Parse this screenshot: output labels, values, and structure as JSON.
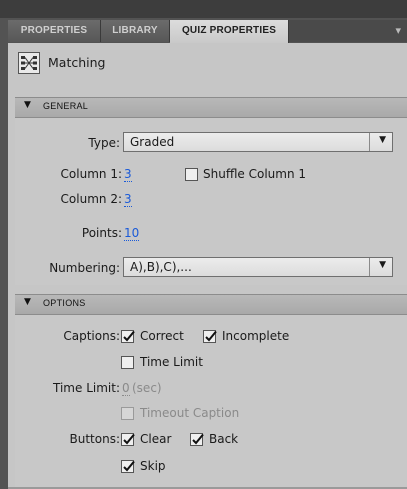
{
  "tabs": [
    {
      "label": "PROPERTIES"
    },
    {
      "label": "LIBRARY"
    },
    {
      "label": "QUIZ PROPERTIES"
    }
  ],
  "header": {
    "title": "Matching",
    "icon": "matching-icon"
  },
  "general": {
    "title": "GENERAL",
    "type_label": "Type:",
    "type_value": "Graded",
    "column1_label": "Column 1:",
    "column1_value": "3",
    "shuffle_label": "Shuffle Column 1",
    "shuffle_checked": false,
    "column2_label": "Column 2:",
    "column2_value": "3",
    "points_label": "Points:",
    "points_value": "10",
    "numbering_label": "Numbering:",
    "numbering_value": "A),B),C),..."
  },
  "options": {
    "title": "OPTIONS",
    "captions_label": "Captions:",
    "correct_label": "Correct",
    "correct_checked": true,
    "incomplete_label": "Incomplete",
    "incomplete_checked": true,
    "time_limit_cb_label": "Time Limit",
    "time_limit_cb_checked": false,
    "time_limit_label": "Time Limit:",
    "time_limit_value": "0",
    "time_limit_unit": "(sec)",
    "timeout_caption_label": "Timeout Caption",
    "timeout_caption_checked": false,
    "buttons_label": "Buttons:",
    "clear_label": "Clear",
    "clear_checked": true,
    "back_label": "Back",
    "back_checked": true,
    "skip_label": "Skip",
    "skip_checked": true
  },
  "colors": {
    "link": "#1a5ad8",
    "panel_bg": "#c6c6c6",
    "chrome_dark": "#535353"
  }
}
